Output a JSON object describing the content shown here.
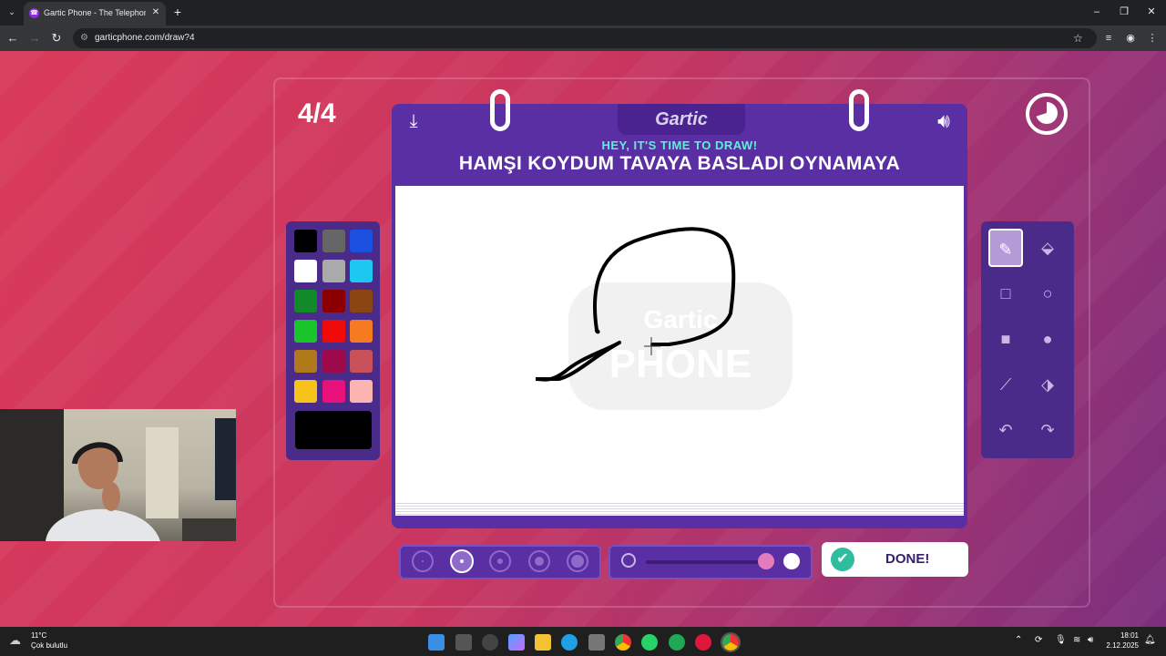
{
  "browser": {
    "tab_title": "Gartic Phone - The Telephone G",
    "url": "garticphone.com/draw?4",
    "close_glyph": "✕",
    "new_tab_glyph": "+"
  },
  "game": {
    "round": "4/4",
    "logo": "Gartic",
    "subtitle": "HEY, IT'S TIME TO DRAW!",
    "phrase": "HAMŞI KOYDUM TAVAYA BASLADI OYNAMAYA",
    "watermark_top": "Gartic",
    "watermark_bottom": "PHONE",
    "done_label": "DONE!"
  },
  "palette": {
    "colors": [
      "#000000",
      "#666666",
      "#1c50e0",
      "#ffffff",
      "#aaaaaa",
      "#1cc8f0",
      "#138a2a",
      "#8a0000",
      "#8b4513",
      "#1cc42c",
      "#f00a0a",
      "#f57a22",
      "#b07a1c",
      "#9c0a4c",
      "#c8525a",
      "#f7c21c",
      "#e8107a",
      "#fbb4b0"
    ],
    "current": "#000000"
  },
  "tools": [
    "pencil-icon",
    "eraser-icon",
    "rectangle-outline-icon",
    "circle-outline-icon",
    "rectangle-filled-icon",
    "circle-filled-icon",
    "line-icon",
    "fill-bucket-icon",
    "undo-icon",
    "redo-icon"
  ],
  "brush": {
    "selected_size_index": 1,
    "opacity_fraction": 0.9
  },
  "taskbar": {
    "weather_temp": "11°C",
    "weather_desc": "Çok bulutlu",
    "time": "18:01",
    "date": "2.12.2025"
  }
}
